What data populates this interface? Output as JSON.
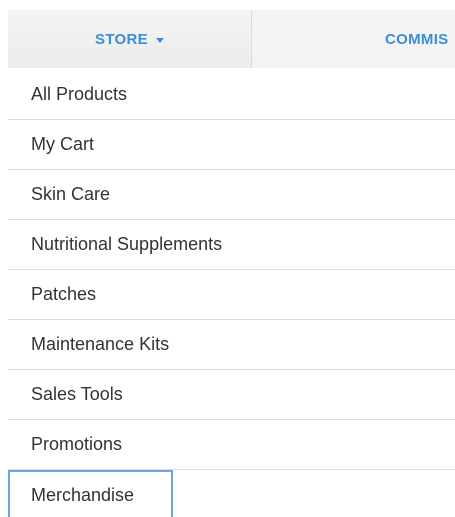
{
  "nav": {
    "store_label": "STORE",
    "commissions_label": "COMMIS"
  },
  "menu": {
    "items": [
      {
        "label": "All Products"
      },
      {
        "label": "My Cart"
      },
      {
        "label": "Skin Care"
      },
      {
        "label": "Nutritional Supplements"
      },
      {
        "label": "Patches"
      },
      {
        "label": "Maintenance Kits"
      },
      {
        "label": "Sales Tools"
      },
      {
        "label": "Promotions"
      },
      {
        "label": "Merchandise"
      }
    ]
  },
  "colors": {
    "accent": "#3c8dd6",
    "active_border": "#6aa7de",
    "nav_bg": "#f1f1f1",
    "text": "#333333"
  }
}
